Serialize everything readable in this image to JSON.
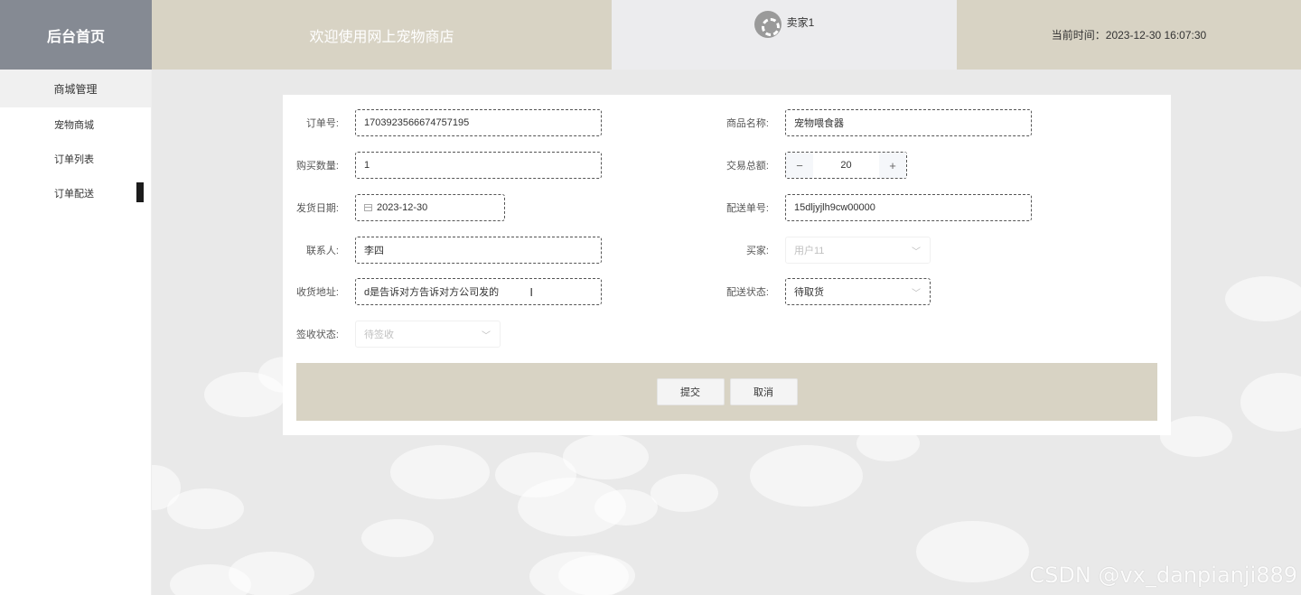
{
  "header": {
    "brand": "后台首页",
    "welcome": "欢迎使用网上宠物商店",
    "user_name": "卖家1",
    "current_time": "当前时间：2023-12-30 16:07:30"
  },
  "sidebar": {
    "group": "商城管理",
    "items": [
      {
        "label": "宠物商城"
      },
      {
        "label": "订单列表"
      },
      {
        "label": "订单配送"
      }
    ]
  },
  "form": {
    "order_no": {
      "label": "订单号:",
      "value": "1703923566674757195"
    },
    "product_name": {
      "label": "商品名称:",
      "value": "宠物喂食器"
    },
    "quantity": {
      "label": "购买数量:",
      "value": "1"
    },
    "total": {
      "label": "交易总额:",
      "value": "20",
      "minus": "−",
      "plus": "+"
    },
    "ship_date": {
      "label": "发货日期:",
      "value": "2023-12-30"
    },
    "tracking_no": {
      "label": "配送单号:",
      "value": "15dljyjlh9cw00000"
    },
    "contact": {
      "label": "联系人:",
      "value": "李四"
    },
    "buyer": {
      "label": "买家:",
      "value": "用户11"
    },
    "address": {
      "label": "收货地址:",
      "value": "d是告诉对方告诉对方公司发的"
    },
    "delivery_status": {
      "label": "配送状态:",
      "value": "待取货"
    },
    "sign_status": {
      "label": "签收状态:",
      "value": "待签收"
    }
  },
  "actions": {
    "submit": "提交",
    "cancel": "取消"
  },
  "watermark": "CSDN @vx_danpianji889"
}
